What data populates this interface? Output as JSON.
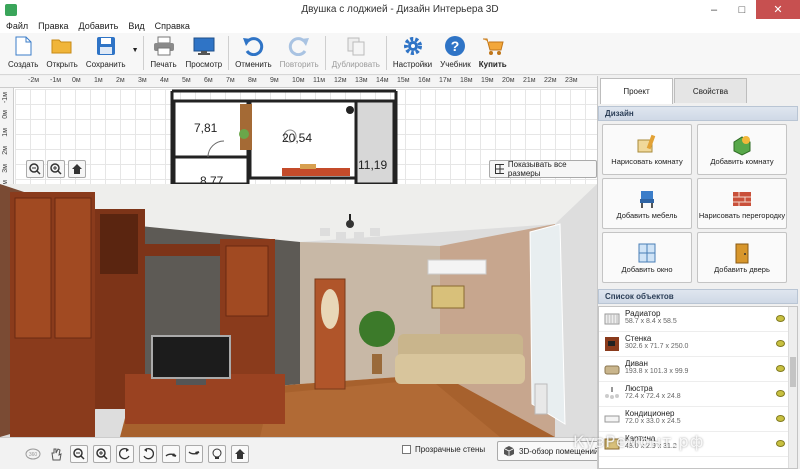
{
  "window": {
    "title": "Двушка с лоджией - Дизайн Интерьера 3D"
  },
  "menu": [
    "Файл",
    "Правка",
    "Добавить",
    "Вид",
    "Справка"
  ],
  "toolbar": {
    "create": "Создать",
    "open": "Открыть",
    "save": "Сохранить",
    "print": "Печать",
    "preview": "Просмотр",
    "undo": "Отменить",
    "redo": "Повторить",
    "duplicate": "Дублировать",
    "settings": "Настройки",
    "tutorial": "Учебник",
    "buy": "Купить"
  },
  "plan": {
    "ruler_top": [
      "-2м",
      "-1м",
      "0м",
      "1м",
      "2м",
      "3м",
      "4м",
      "5м",
      "6м",
      "7м",
      "8м",
      "9м",
      "10м",
      "11м",
      "12м",
      "13м",
      "14м",
      "15м",
      "16м",
      "17м",
      "18м",
      "19м",
      "20м",
      "21м",
      "22м",
      "23м"
    ],
    "ruler_left": [
      "-1м",
      "0м",
      "1м",
      "2м",
      "3м",
      "4м"
    ],
    "rooms": [
      "7,81",
      "20,54",
      "11,19",
      "8,77"
    ],
    "show_dims_label": "Показывать все размеры"
  },
  "bottom": {
    "transparent_walls": "Прозрачные стены",
    "overview_3d": "3D-обзор помещений"
  },
  "right_panel": {
    "tabs": [
      "Проект",
      "Свойства"
    ],
    "design_header": "Дизайн",
    "design_buttons": [
      {
        "label": "Нарисовать комнату"
      },
      {
        "label": "Добавить комнату"
      },
      {
        "label": "Добавить мебель"
      },
      {
        "label": "Нарисовать перегородку"
      },
      {
        "label": "Добавить окно"
      },
      {
        "label": "Добавить дверь"
      }
    ],
    "objects_header": "Список объектов",
    "objects": [
      {
        "name": "Радиатор",
        "dims": "58.7 x 8.4 x 58.5"
      },
      {
        "name": "Стенка",
        "dims": "302.6 x 71.7 x 250.0"
      },
      {
        "name": "Диван",
        "dims": "193.8 x 101.3 x 99.9"
      },
      {
        "name": "Люстра",
        "dims": "72.4 x 72.4 x 24.8"
      },
      {
        "name": "Кондиционер",
        "dims": "72.0 x 33.0 x 24.5"
      },
      {
        "name": "Картина",
        "dims": "48.0 x 2.9 x 31.2"
      }
    ]
  },
  "watermark": "КузРемонт.рф",
  "colors": {
    "accent": "#3b7dc9",
    "wall": "#6b5a4a",
    "floor": "#9b5c2e",
    "cabinet": "#8a3b1c"
  }
}
